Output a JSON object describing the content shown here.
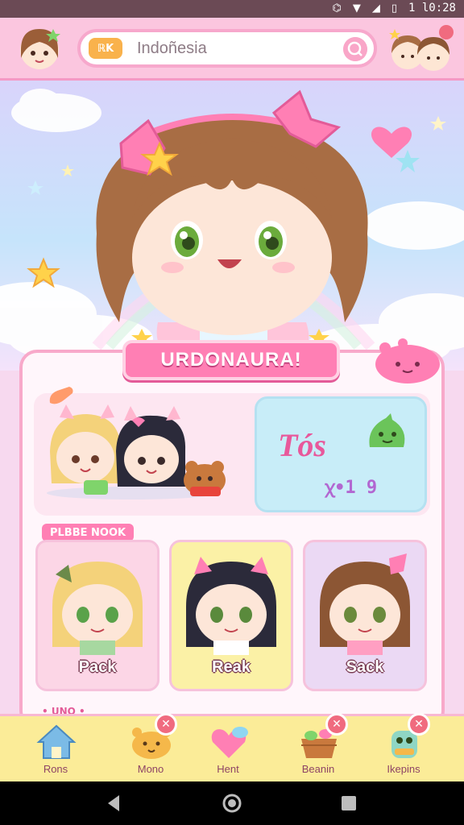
{
  "status_bar": {
    "time": "1 l0:28",
    "icons": [
      "notification-icon",
      "wifi-icon",
      "signal-icon",
      "battery-icon"
    ]
  },
  "header": {
    "search": {
      "tag": "ℝK",
      "value": "Indoñesia"
    }
  },
  "hero": {
    "title": "URDONAURA!"
  },
  "feature": {
    "stats_title": "Tós",
    "stats_value": "ꭓ•1 9"
  },
  "section_label": "PLBBE NOOK",
  "characters": [
    {
      "name": "Pack"
    },
    {
      "name": "Reak"
    },
    {
      "name": "Sack"
    }
  ],
  "next_section_label": "•  UNO  •",
  "bottom_nav": {
    "items": [
      {
        "label": "Rons",
        "icon": "house-icon"
      },
      {
        "label": "Mono",
        "icon": "bear-face-icon",
        "badge": "✕"
      },
      {
        "label": "Hent",
        "icon": "heart-icon"
      },
      {
        "label": "Beanin",
        "icon": "basket-icon",
        "badge": "✕"
      },
      {
        "label": "Ikepins",
        "icon": "frog-jar-icon",
        "badge": "✕"
      }
    ]
  },
  "colors": {
    "accent_pink": "#ff7fb4",
    "header_pink": "#fbc6df",
    "nav_yellow": "#fbec98",
    "badge_red": "#f06b7f",
    "stats_blue": "#c8edf8"
  }
}
